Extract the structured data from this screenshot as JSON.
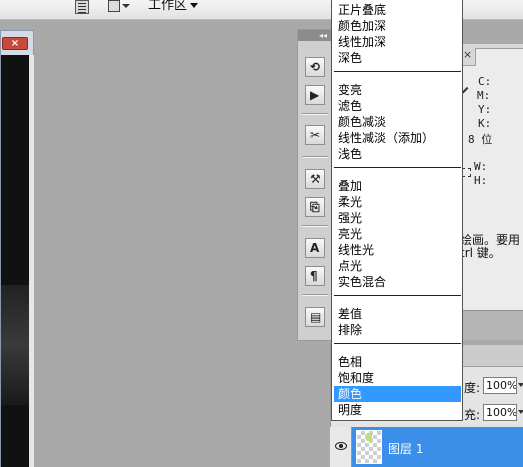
{
  "toolbar": {
    "workspace_label": "工作区"
  },
  "dock": {
    "collapse_glyph": "◂◂",
    "tools": [
      {
        "name": "history-tool-icon",
        "glyph": "⟲"
      },
      {
        "name": "actions-play-icon",
        "glyph": "▶"
      },
      {
        "name": "brushes-icon",
        "glyph": "✂"
      },
      {
        "name": "tool-presets-icon",
        "glyph": "⚒"
      },
      {
        "name": "clone-source-icon",
        "glyph": "⎘"
      },
      {
        "name": "character-icon",
        "glyph": "A"
      },
      {
        "name": "paragraph-icon",
        "glyph": "¶"
      },
      {
        "name": "layer-comps-icon",
        "glyph": "▤"
      }
    ]
  },
  "info_panel": {
    "close_glyph": "×",
    "c": "C:",
    "m": "M:",
    "y": "Y:",
    "k": "K:",
    "bits": "8 位",
    "w": "W:",
    "h": "H:",
    "hint_line1": "绘画。要用",
    "hint_line2": "trl 键。"
  },
  "layers_panel": {
    "opacity_label": "度:",
    "opacity_value": "100%",
    "fill_label": "充:",
    "fill_value": "100%",
    "layer_name": "图层 1"
  },
  "blend_menu": {
    "groups": [
      [
        "正片叠底",
        "颜色加深",
        "线性加深",
        "深色"
      ],
      [
        "变亮",
        "滤色",
        "颜色减淡",
        "线性减淡（添加）",
        "浅色"
      ],
      [
        "叠加",
        "柔光",
        "强光",
        "亮光",
        "线性光",
        "点光",
        "实色混合"
      ],
      [
        "差值",
        "排除"
      ],
      [
        "色相",
        "饱和度",
        "颜色",
        "明度"
      ]
    ],
    "selected": "颜色"
  },
  "colors": {
    "selection": "#3399ff",
    "layer_highlight": "#3c8fe8",
    "workspace_bg": "#a9a9a9"
  }
}
